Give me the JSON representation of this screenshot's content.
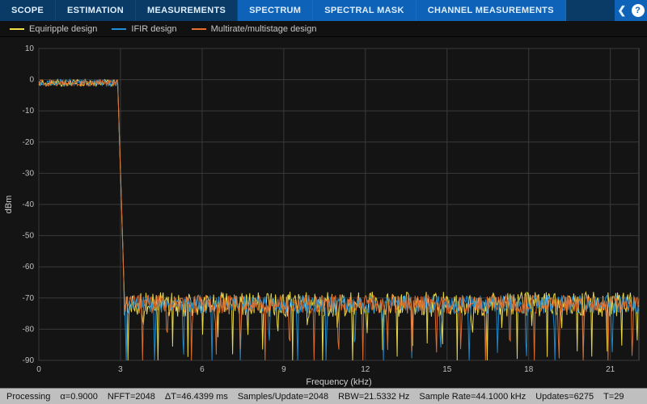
{
  "nav": {
    "tabs": [
      {
        "label": "SCOPE",
        "active": false
      },
      {
        "label": "ESTIMATION",
        "active": false
      },
      {
        "label": "MEASUREMENTS",
        "active": false
      },
      {
        "label": "SPECTRUM",
        "active": true
      },
      {
        "label": "SPECTRAL MASK",
        "active": true
      },
      {
        "label": "CHANNEL MEASUREMENTS",
        "active": true
      }
    ],
    "help_glyph": "?"
  },
  "legend": {
    "items": [
      {
        "label": "Equiripple design",
        "color": "#f2e24a"
      },
      {
        "label": "IFIR design",
        "color": "#1f8fd6"
      },
      {
        "label": "Multirate/multistage design",
        "color": "#e8702a"
      }
    ]
  },
  "chart_data": {
    "type": "line",
    "title": "",
    "xlabel": "Frequency (kHz)",
    "ylabel": "dBm",
    "xlim": [
      0,
      22.05
    ],
    "ylim": [
      -90,
      10
    ],
    "xticks": [
      0,
      3,
      6,
      9,
      12,
      15,
      18,
      21
    ],
    "yticks": [
      10,
      0,
      -10,
      -20,
      -30,
      -40,
      -50,
      -60,
      -70,
      -80,
      -90
    ],
    "series": [
      {
        "name": "Equiripple design",
        "color": "#f2e24a",
        "passband_end_khz": 3.0,
        "passband_level_db": -1,
        "stopband_mean_db": -72,
        "stopband_ripple_db": 8,
        "notch_depth_db": -90
      },
      {
        "name": "IFIR design",
        "color": "#1f8fd6",
        "passband_end_khz": 3.0,
        "passband_level_db": -1,
        "stopband_mean_db": -72,
        "stopband_ripple_db": 6,
        "notch_depth_db": -90
      },
      {
        "name": "Multirate/multistage design",
        "color": "#e8702a",
        "passband_end_khz": 3.0,
        "passband_level_db": -1,
        "stopband_mean_db": -72,
        "stopband_ripple_db": 6,
        "notch_depth_db": -90
      }
    ]
  },
  "status": {
    "state": "Processing",
    "alpha": "α=0.9000",
    "nfft": "NFFT=2048",
    "dt": "ΔT=46.4399 ms",
    "spu": "Samples/Update=2048",
    "rbw": "RBW=21.5332 Hz",
    "srate": "Sample Rate=44.1000 kHz",
    "updates": "Updates=6275",
    "t": "T=29"
  }
}
